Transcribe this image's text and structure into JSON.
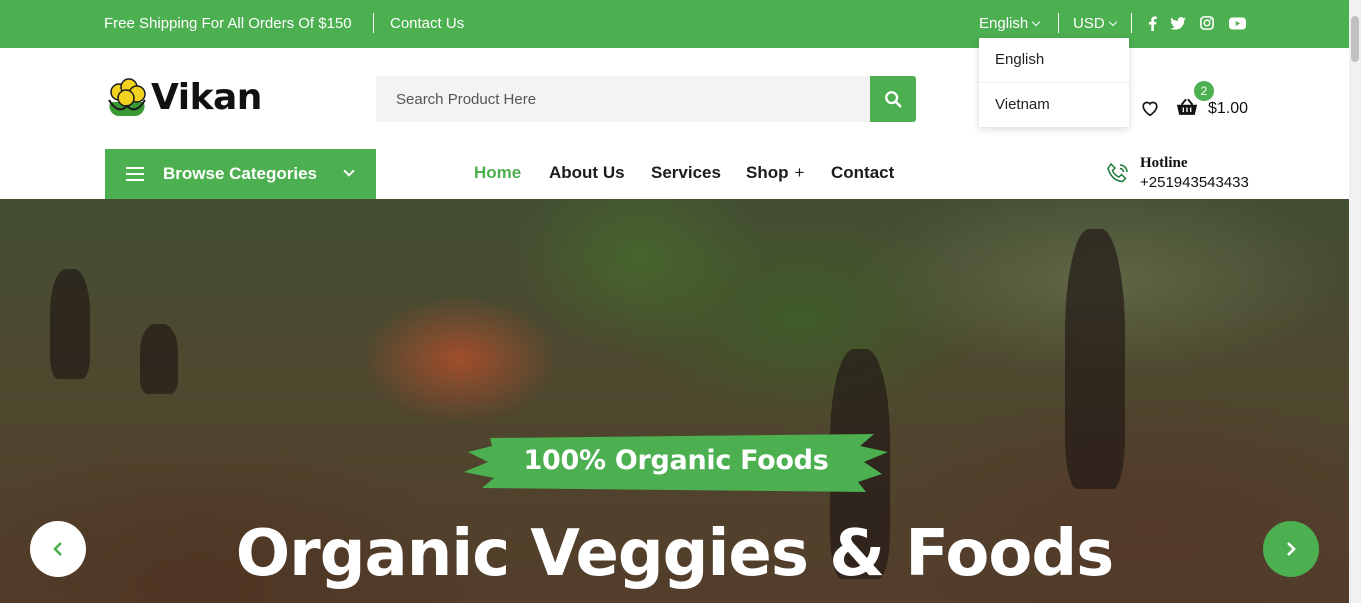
{
  "topbar": {
    "shipping_text": "Free Shipping For All Orders Of $150",
    "contact_label": "Contact Us",
    "language_label": "English",
    "currency_label": "USD",
    "social": [
      "facebook-icon",
      "twitter-icon",
      "instagram-icon",
      "youtube-icon"
    ]
  },
  "language_dropdown": {
    "options": [
      "English",
      "Vietnam"
    ]
  },
  "header": {
    "brand": "Vikan",
    "search_placeholder": "Search Product Here",
    "cart_count": "2",
    "cart_total": "$1.00"
  },
  "nav": {
    "browse_label": "Browse Categories",
    "items": [
      {
        "label": "Home",
        "active": true
      },
      {
        "label": "About Us"
      },
      {
        "label": "Services"
      },
      {
        "label": "Shop",
        "suffix": "+"
      },
      {
        "label": "Contact"
      }
    ],
    "hotline_title": "Hotline",
    "hotline_number": "+251943543433"
  },
  "hero": {
    "tagline": "100% Organic Foods",
    "title": "Organic Veggies & Foods"
  },
  "colors": {
    "accent": "#4caf50",
    "text": "#1c1c1c"
  }
}
